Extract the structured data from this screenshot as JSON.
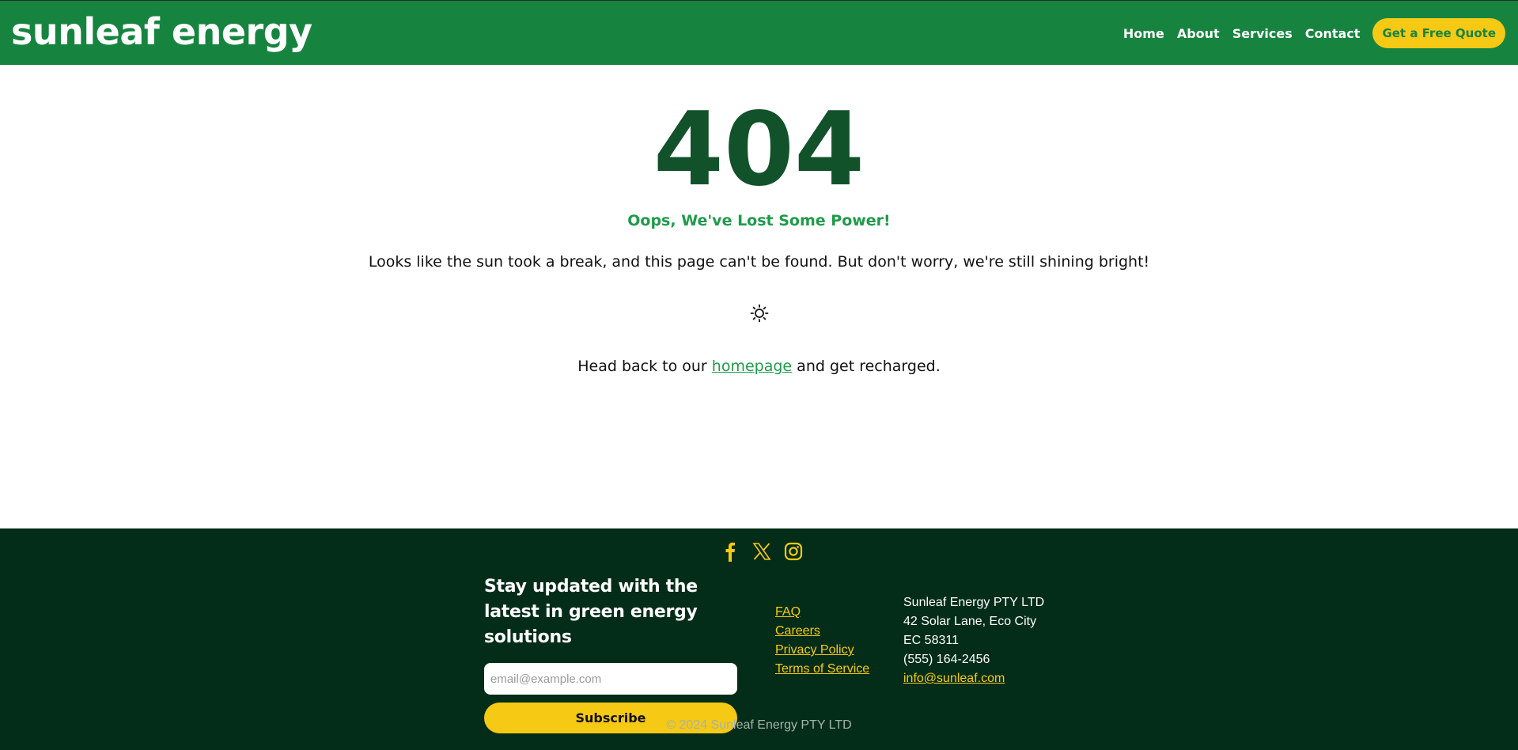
{
  "header": {
    "logo": "sunleaf energy",
    "nav": [
      "Home",
      "About",
      "Services",
      "Contact"
    ],
    "cta": "Get a Free Quote"
  },
  "main": {
    "code": "404",
    "subtitle": "Oops, We've Lost Some Power!",
    "description": "Looks like the sun took a break, and this page can't be found. But don't worry, we're still shining bright!",
    "icon": "sun-icon",
    "back_prefix": "Head back to our",
    "back_link": "homepage",
    "back_suffix": "and get recharged."
  },
  "footer": {
    "social_icons": [
      "facebook-icon",
      "x-icon",
      "instagram-icon"
    ],
    "newsletter_title": "Stay updated with the latest in green energy solutions",
    "email_placeholder": "email@example.com",
    "subscribe_label": "Subscribe",
    "links": [
      "FAQ",
      "Careers",
      "Privacy Policy",
      "Terms of Service"
    ],
    "company": "Sunleaf Energy PTY LTD",
    "address_line1": "42 Solar Lane, Eco City",
    "address_line2": "EC 58311",
    "phone": "(555) 164-2456",
    "email": "info@sunleaf.com",
    "copyright": "© 2024 Sunleaf Energy PTY LTD"
  },
  "colors": {
    "brand_green": "#16843f",
    "dark_green": "#042d19",
    "accent_yellow": "#f6c915",
    "heading_green": "#12522b"
  }
}
